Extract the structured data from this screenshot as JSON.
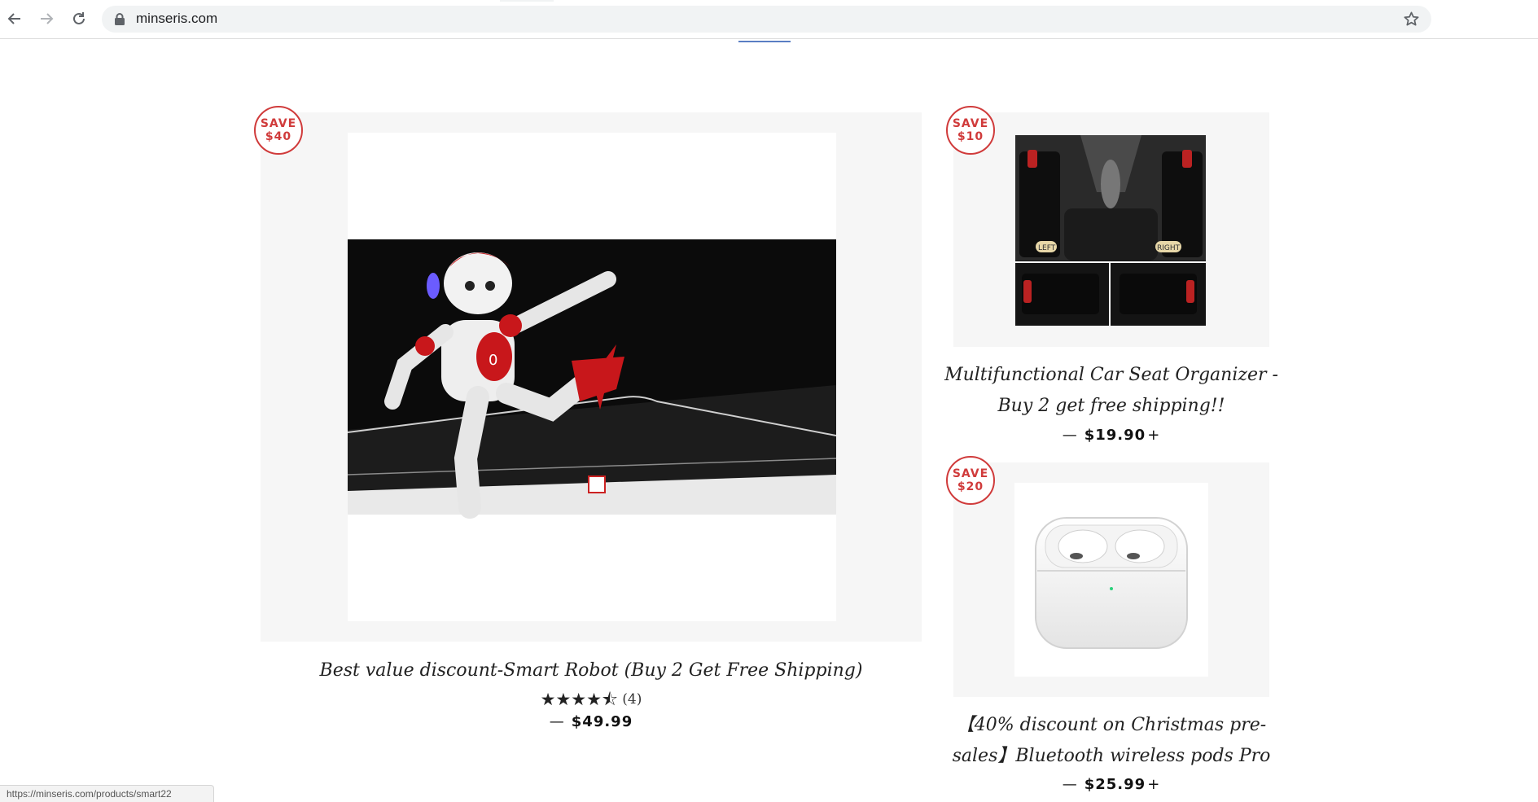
{
  "browser": {
    "url": "minseris.com",
    "status_url": "https://minseris.com/products/smart22"
  },
  "products": [
    {
      "badge_line1": "SAVE",
      "badge_line2": "$40",
      "title": "Best value discount-Smart Robot (Buy 2 Get Free Shipping)",
      "stars": "★★★★⯪",
      "rating_count": "(4)",
      "price_dash": "—",
      "price": "$49.99",
      "price_suffix": ""
    },
    {
      "badge_line1": "SAVE",
      "badge_line2": "$10",
      "title_line1": "Multifunctional Car Seat Organizer -",
      "title_line2": "Buy 2 get free shipping!!",
      "price_dash": "—",
      "price": "$19.90",
      "price_suffix": "+",
      "image_labels": {
        "left": "LEFT",
        "right": "RIGHT"
      }
    },
    {
      "badge_line1": "SAVE",
      "badge_line2": "$20",
      "title_line1": "【40% discount on Christmas pre-",
      "title_line2": "sales】Bluetooth wireless pods Pro",
      "price_dash": "—",
      "price": "$25.99",
      "price_suffix": "+"
    }
  ],
  "colors": {
    "badge": "#d03b3b",
    "card_bg": "#f6f6f6",
    "accent_underline": "#5a7ec3"
  }
}
